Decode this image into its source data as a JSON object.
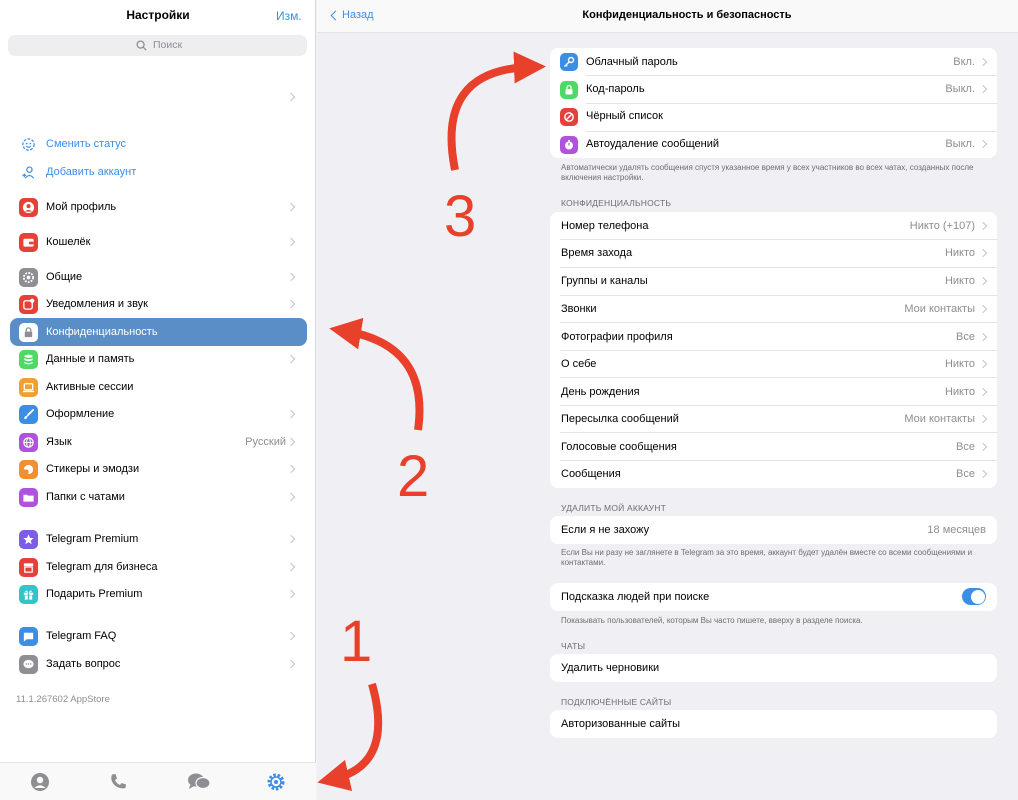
{
  "sidebar": {
    "title": "Настройки",
    "edit_label": "Изм.",
    "search_placeholder": "Поиск",
    "set_status": "Сменить статус",
    "add_account": "Добавить аккаунт",
    "items": [
      {
        "label": "Мой профиль",
        "icon": "person-icon",
        "color": "#e5403a"
      },
      {
        "label": "Кошелёк",
        "icon": "wallet-icon",
        "color": "#e5403a"
      },
      {
        "label": "Общие",
        "icon": "gear-icon",
        "color": "#8e8e93"
      },
      {
        "label": "Уведомления и звук",
        "icon": "bell-icon",
        "color": "#e5403a"
      },
      {
        "label": "Конфиденциальность",
        "icon": "lock-icon",
        "color": "#8e8e93"
      },
      {
        "label": "Данные и память",
        "icon": "database-icon",
        "color": "#4cd964"
      },
      {
        "label": "Активные сессии",
        "icon": "laptop-icon",
        "color": "#f0a030"
      },
      {
        "label": "Оформление",
        "icon": "brush-icon",
        "color": "#3a8ee6"
      },
      {
        "label": "Язык",
        "value": "Русский",
        "icon": "globe-icon",
        "color": "#af52de"
      },
      {
        "label": "Стикеры и эмодзи",
        "icon": "sticker-icon",
        "color": "#f09030"
      },
      {
        "label": "Папки с чатами",
        "icon": "folder-icon",
        "color": "#af52de"
      },
      {
        "label": "Telegram Premium",
        "icon": "star-icon",
        "color": "#7d5ce6"
      },
      {
        "label": "Telegram для бизнеса",
        "icon": "shop-icon",
        "color": "#e5403a"
      },
      {
        "label": "Подарить Premium",
        "icon": "gift-icon",
        "color": "#34c3c8"
      },
      {
        "label": "Telegram FAQ",
        "icon": "question-icon",
        "color": "#3a8ee6"
      },
      {
        "label": "Задать вопрос",
        "icon": "chat-bubble-icon",
        "color": "#8e8e93"
      }
    ],
    "version": "11.1.267602 AppStore"
  },
  "tabbar": {
    "items": [
      "contacts-icon",
      "calls-icon",
      "chats-icon",
      "settings-icon"
    ],
    "active_color": "#3a8ee6"
  },
  "main": {
    "back_label": "Назад",
    "title": "Конфиденциальность и безопасность",
    "security": [
      {
        "label": "Облачный пароль",
        "value": "Вкл.",
        "icon": "key-icon",
        "color": "#3a8ee6"
      },
      {
        "label": "Код-пароль",
        "value": "Выкл.",
        "icon": "lock-icon",
        "color": "#4cd964"
      },
      {
        "label": "Чёрный список",
        "value": "",
        "icon": "block-icon",
        "color": "#e5403a"
      },
      {
        "label": "Автоудаление сообщений",
        "value": "Выкл.",
        "icon": "timer-icon",
        "color": "#af52de"
      }
    ],
    "security_footer": "Автоматически удалять сообщения спустя указанное время у всех участников во всех чатах, созданных после включения настройки.",
    "privacy_header": "КОНФИДЕНЦИАЛЬНОСТЬ",
    "privacy": [
      {
        "label": "Номер телефона",
        "value": "Никто (+107)"
      },
      {
        "label": "Время захода",
        "value": "Никто"
      },
      {
        "label": "Группы и каналы",
        "value": "Никто"
      },
      {
        "label": "Звонки",
        "value": "Мои контакты"
      },
      {
        "label": "Фотографии профиля",
        "value": "Все"
      },
      {
        "label": "О себе",
        "value": "Никто"
      },
      {
        "label": "День рождения",
        "value": "Никто"
      },
      {
        "label": "Пересылка сообщений",
        "value": "Мои контакты"
      },
      {
        "label": "Голосовые сообщения",
        "value": "Все"
      },
      {
        "label": "Сообщения",
        "value": "Все"
      }
    ],
    "delete_header": "УДАЛИТЬ МОЙ АККАУНТ",
    "delete_label": "Если я не захожу",
    "delete_value": "18 месяцев",
    "delete_footer": "Если Вы ни разу не заглянете в Telegram за это время, аккаунт будет удалён вместе со всеми сообщениями и контактами.",
    "suggest_label": "Подсказка людей при поиске",
    "suggest_on": true,
    "suggest_footer": "Показывать пользователей, которым Вы часто пишете, вверху в разделе поиска.",
    "chats_header": "ЧАТЫ",
    "delete_drafts": "Удалить черновики",
    "sites_header": "ПОДКЛЮЧЁННЫЕ САЙТЫ",
    "authorized_sites": "Авторизованные сайты"
  },
  "annotations": {
    "numbers": [
      "1",
      "2",
      "3"
    ],
    "color": "#e8402a"
  }
}
